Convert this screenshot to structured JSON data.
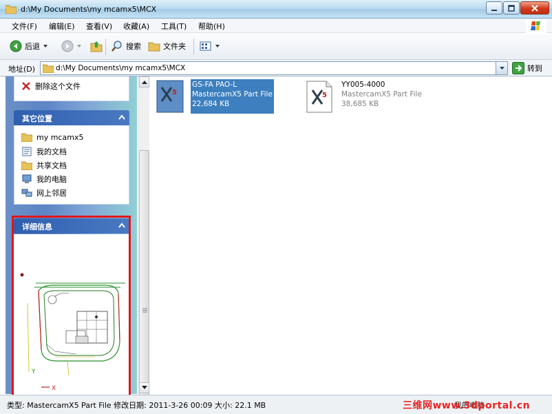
{
  "window": {
    "title": "d:\\My Documents\\my mcamx5\\MCX"
  },
  "menu": [
    "文件(F)",
    "编辑(E)",
    "查看(V)",
    "收藏(A)",
    "工具(T)",
    "帮助(H)"
  ],
  "toolbar": {
    "back": "后退",
    "search": "搜索",
    "folders": "文件夹"
  },
  "address": {
    "label": "地址(D)",
    "path": "d:\\My Documents\\my mcamx5\\MCX",
    "go": "转到"
  },
  "tasks": {
    "delete_file": "删除这个文件"
  },
  "other_places": {
    "title": "其它位置",
    "items": [
      {
        "label": "my mcamx5",
        "icon": "folder-icon"
      },
      {
        "label": "我的文档",
        "icon": "documents-icon"
      },
      {
        "label": "共享文档",
        "icon": "folder-icon"
      },
      {
        "label": "我的电脑",
        "icon": "computer-icon"
      },
      {
        "label": "网上邻居",
        "icon": "network-icon"
      }
    ]
  },
  "details": {
    "title": "详细信息"
  },
  "files": [
    {
      "name": "GS-FA PAO-L",
      "type": "MastercamX5 Part File",
      "size": "22,684 KB",
      "selected": true
    },
    {
      "name": "YY005-4000",
      "type": "MastercamX5 Part File",
      "size": "38,685 KB",
      "selected": false
    }
  ],
  "status": {
    "text": "类型: MastercamX5 Part File 修改日期: 2011-3-26 00:09 大小: 22.1 MB",
    "right": "我的电脑",
    "watermark": "三维网www.3dportal.cn"
  },
  "colors": {
    "highlight": "#e3151a",
    "selection": "#3d7fbf",
    "panel_header": "#2f5fae"
  }
}
